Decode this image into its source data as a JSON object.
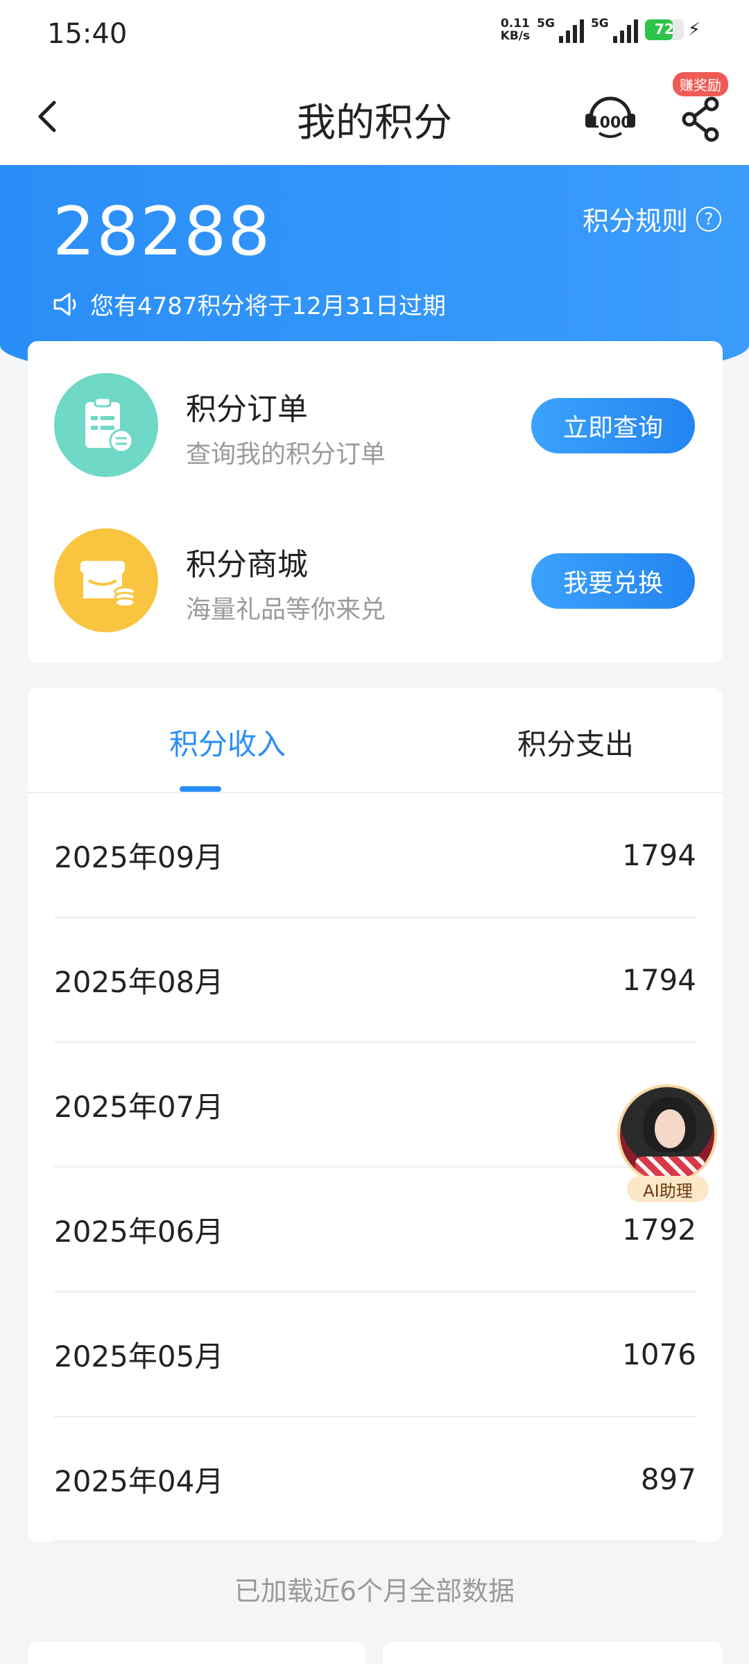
{
  "status_bar": {
    "time": "15:40",
    "net_speed_value": "0.11",
    "net_speed_unit": "KB/s",
    "signal1_label": "5G",
    "signal2_label": "5G",
    "battery_level": "72"
  },
  "header": {
    "title": "我的积分",
    "reward_badge": "赚奖励",
    "service_icon": "customer-service-10000-icon",
    "share_icon": "share-icon"
  },
  "banner": {
    "points_total": "28288",
    "rules_label": "积分规则",
    "expire_note": "您有4787积分将于12月31日过期"
  },
  "actions": [
    {
      "title": "积分订单",
      "subtitle": "查询我的积分订单",
      "button": "立即查询",
      "icon": "order-clipboard-icon",
      "color": "#6fd8c7"
    },
    {
      "title": "积分商城",
      "subtitle": "海量礼品等你来兑",
      "button": "我要兑换",
      "icon": "shop-store-icon",
      "color": "#f9c540"
    }
  ],
  "tabs": {
    "income": "积分收入",
    "expense": "积分支出",
    "active": "income"
  },
  "records": [
    {
      "month": "2025年09月",
      "points": "1794"
    },
    {
      "month": "2025年08月",
      "points": "1794"
    },
    {
      "month": "2025年07月",
      "points": ""
    },
    {
      "month": "2025年06月",
      "points": "1792"
    },
    {
      "month": "2025年05月",
      "points": "1076"
    },
    {
      "month": "2025年04月",
      "points": "897"
    }
  ],
  "footer_note": "已加载近6个月全部数据",
  "ai_assistant": {
    "label": "AI助理"
  },
  "colors": {
    "brand_blue": "#2a8ef8",
    "accent_red": "#ee5b55"
  }
}
